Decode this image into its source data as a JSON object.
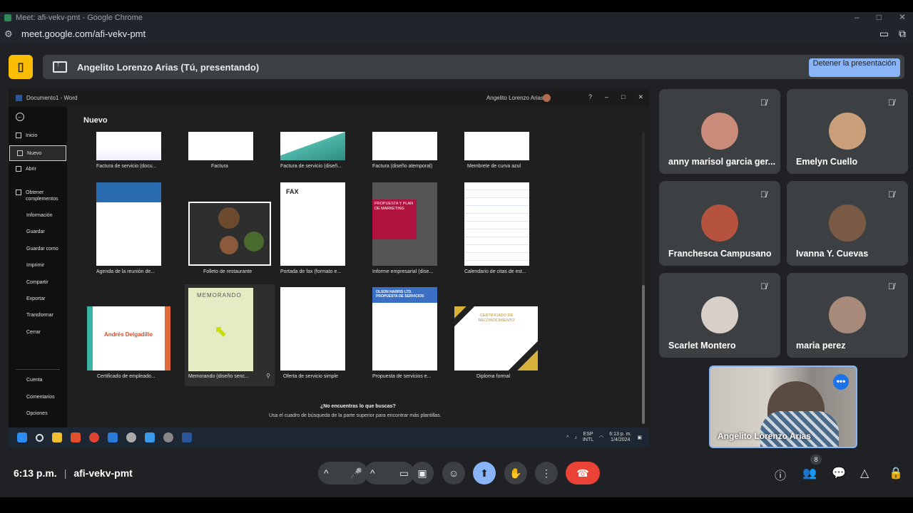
{
  "browser": {
    "title": "Meet: afi-vekv-pmt - Google Chrome",
    "url": "meet.google.com/afi-vekv-pmt"
  },
  "banner": {
    "presenter_text": "Angelito Lorenzo Arias (Tú, presentando)",
    "stop_label": "Detener la presentación"
  },
  "word": {
    "window_title": "Documento1 - Word",
    "user": "Angelito Lorenzo Arias",
    "section": "Nuevo",
    "sidebar": {
      "inicio": "Inicio",
      "nuevo": "Nuevo",
      "abrir": "Abrir",
      "obtener": "Obtener complementos",
      "informacion": "Información",
      "guardar": "Guardar",
      "guardar_como": "Guardar como",
      "imprimir": "Imprimir",
      "compartir": "Compartir",
      "exportar": "Exportar",
      "transformar": "Transformar",
      "cerrar": "Cerrar",
      "cuenta": "Cuenta",
      "comentarios": "Comentarios",
      "opciones": "Opciones"
    },
    "templates": [
      "Factura de servicio (docu...",
      "Factura",
      "Factura de servicio (diseñ...",
      "Factura (diseño atemporal)",
      "Membrete de curva azul",
      "Agenda de la reunión de...",
      "Folleto de restaurante",
      "Portada de fax (formato e...",
      "Informe empresarial (dise...",
      "Calendario de citas de est...",
      "Certificado de empleado...",
      "Memorando (diseño senc...",
      "Oferta de servicio simple",
      "Propuesta de servicios e...",
      "Diploma formal"
    ],
    "thumb_text": {
      "fax": "FAX",
      "informe": "PROPUESTA Y PLAN DE MARKETING",
      "certificado_name": "Andrés Delgadillo",
      "memorando": "MEMORANDO",
      "propuesta": "OLSON HARRIS LTD. PROPUESTA DE SERVICIOS",
      "diploma": "CERTIFICADO DE RECONOCIMIENTO"
    },
    "not_found_title": "¿No encuentras lo que buscas?",
    "not_found_hint": "Usa el cuadro de búsqueda de la parte superior para encontrar más plantillas."
  },
  "taskbar": {
    "lang": "ESP",
    "layout": "INTL",
    "time": "6:13 p. m.",
    "date": "1/4/2024"
  },
  "participants": [
    {
      "name": "anny marisol garcia ger...",
      "color": "#c98b7a"
    },
    {
      "name": "Emelyn Cuello",
      "color": "#c9a07a"
    },
    {
      "name": "Franchesca Campusano",
      "color": "#b5533f"
    },
    {
      "name": "Ivanna Y. Cuevas",
      "color": "#7a5a44"
    },
    {
      "name": "Scarlet Montero",
      "color": "#d8d0c8"
    },
    {
      "name": "maria perez",
      "color": "#a88a7a"
    }
  ],
  "self_view": {
    "name": "Angelito Lorenzo Arias"
  },
  "bottom": {
    "time": "6:13 p.m.",
    "separator": "|",
    "meeting_code": "afi-vekv-pmt",
    "participant_count": "8"
  },
  "colors": {
    "background": "#202124",
    "tile": "#3c4043",
    "accent": "#8ab4f8",
    "end_call": "#ea4335"
  }
}
